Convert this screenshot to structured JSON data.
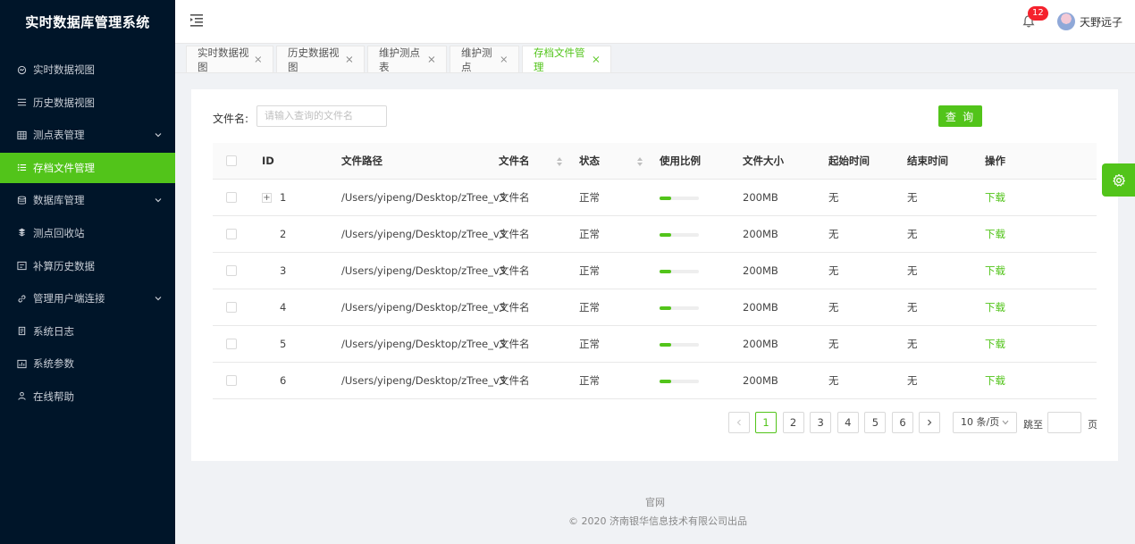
{
  "app": {
    "title": "实时数据库管理系统"
  },
  "sidebar": {
    "items": [
      {
        "label": "实时数据视图",
        "icon": "realtime-icon",
        "has_children": false,
        "active": false
      },
      {
        "label": "历史数据视图",
        "icon": "history-list-icon",
        "has_children": false,
        "active": false
      },
      {
        "label": "测点表管理",
        "icon": "table-icon",
        "has_children": true,
        "active": false
      },
      {
        "label": "存档文件管理",
        "icon": "list-icon",
        "has_children": false,
        "active": true
      },
      {
        "label": "数据库管理",
        "icon": "database-icon",
        "has_children": true,
        "active": false
      },
      {
        "label": "测点回收站",
        "icon": "recycle-icon",
        "has_children": false,
        "active": false
      },
      {
        "label": "补算历史数据",
        "icon": "calc-icon",
        "has_children": false,
        "active": false
      },
      {
        "label": "管理用户端连接",
        "icon": "link-icon",
        "has_children": true,
        "active": false
      },
      {
        "label": "系统日志",
        "icon": "log-icon",
        "has_children": false,
        "active": false
      },
      {
        "label": "系统参数",
        "icon": "params-icon",
        "has_children": false,
        "active": false
      },
      {
        "label": "在线帮助",
        "icon": "help-icon",
        "has_children": false,
        "active": false
      }
    ]
  },
  "header": {
    "notifications": "12",
    "username": "天野远子"
  },
  "tabs": [
    {
      "label": "实时数据视图",
      "active": false
    },
    {
      "label": "历史数据视图",
      "active": false
    },
    {
      "label": "维护测点表",
      "active": false
    },
    {
      "label": "维护测点",
      "active": false
    },
    {
      "label": "存档文件管理",
      "active": true
    }
  ],
  "filter": {
    "label": "文件名:",
    "placeholder": "请输入查询的文件名",
    "query_button": "查 询"
  },
  "table": {
    "columns": [
      "ID",
      "文件路径",
      "文件名",
      "状态",
      "使用比例",
      "文件大小",
      "起始时间",
      "结束时间",
      "操作"
    ],
    "rows": [
      {
        "id": "1",
        "path": "/Users/yipeng/Desktop/zTree_v3",
        "name": "文件名",
        "status": "正常",
        "usage": 30,
        "usage_text": "30%",
        "size": "200MB",
        "start": "无",
        "end": "无",
        "action": "下载",
        "expandable": true
      },
      {
        "id": "2",
        "path": "/Users/yipeng/Desktop/zTree_v3",
        "name": "文件名",
        "status": "正常",
        "usage": 30,
        "usage_text": "30%",
        "size": "200MB",
        "start": "无",
        "end": "无",
        "action": "下载",
        "expandable": false
      },
      {
        "id": "3",
        "path": "/Users/yipeng/Desktop/zTree_v3",
        "name": "文件名",
        "status": "正常",
        "usage": 30,
        "usage_text": "30%",
        "size": "200MB",
        "start": "无",
        "end": "无",
        "action": "下载",
        "expandable": false
      },
      {
        "id": "4",
        "path": "/Users/yipeng/Desktop/zTree_v3",
        "name": "文件名",
        "status": "正常",
        "usage": 30,
        "usage_text": "30%",
        "size": "200MB",
        "start": "无",
        "end": "无",
        "action": "下载",
        "expandable": false
      },
      {
        "id": "5",
        "path": "/Users/yipeng/Desktop/zTree_v3",
        "name": "文件名",
        "status": "正常",
        "usage": 30,
        "usage_text": "30%",
        "size": "200MB",
        "start": "无",
        "end": "无",
        "action": "下载",
        "expandable": false
      },
      {
        "id": "6",
        "path": "/Users/yipeng/Desktop/zTree_v3",
        "name": "文件名",
        "status": "正常",
        "usage": 30,
        "usage_text": "30%",
        "size": "200MB",
        "start": "无",
        "end": "无",
        "action": "下载",
        "expandable": false
      }
    ]
  },
  "pagination": {
    "pages": [
      "1",
      "2",
      "3",
      "4",
      "5",
      "6"
    ],
    "current": "1",
    "page_size": "10 条/页",
    "jump_label": "跳至",
    "jump_suffix": "页"
  },
  "footer": {
    "link": "官网",
    "copyright": "© 2020 济南银华信息技术有限公司出品"
  },
  "colors": {
    "accent": "#52c41a",
    "sidebar_bg": "#001529",
    "badge": "#f5222d"
  }
}
